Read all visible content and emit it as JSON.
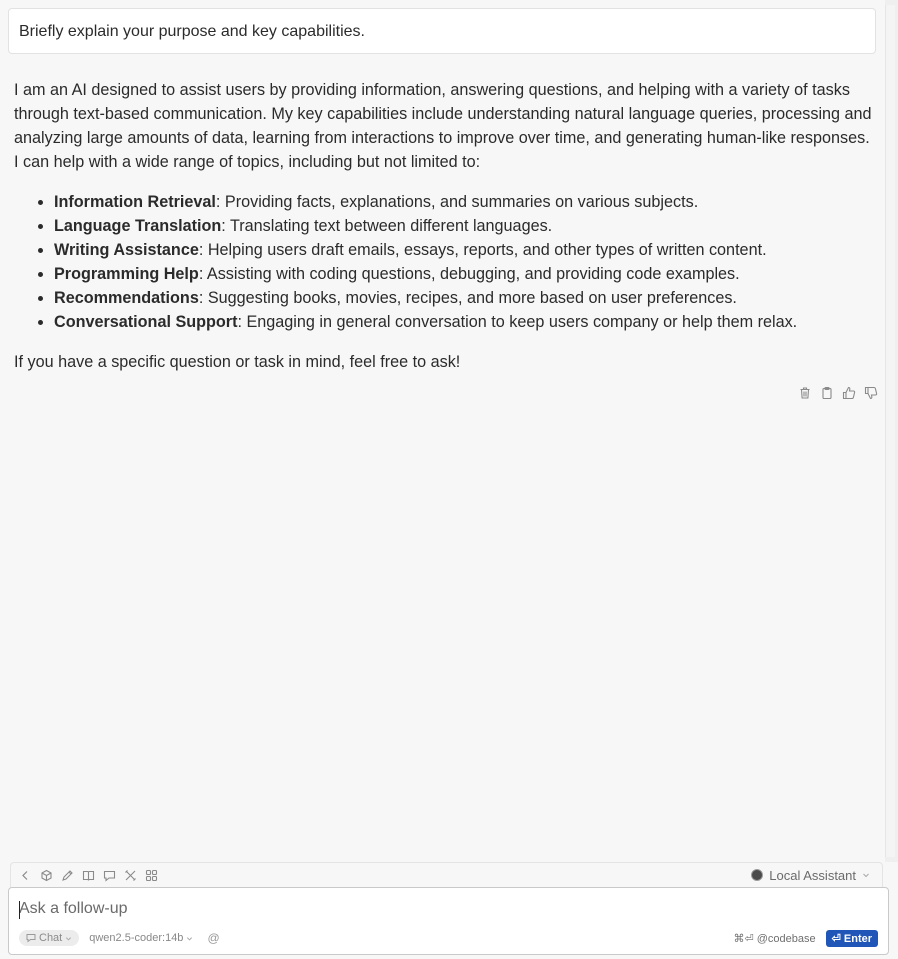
{
  "user_message": "Briefly explain your purpose and key capabilities.",
  "answer": {
    "intro": "I am an AI designed to assist users by providing information, answering questions, and helping with a variety of tasks through text-based communication. My key capabilities include understanding natural language queries, processing and analyzing large amounts of data, learning from interactions to improve over time, and generating human-like responses. I can help with a wide range of topics, including but not limited to:",
    "items": [
      {
        "term": "Information Retrieval",
        "desc": ": Providing facts, explanations, and summaries on various subjects."
      },
      {
        "term": "Language Translation",
        "desc": ": Translating text between different languages."
      },
      {
        "term": "Writing Assistance",
        "desc": ": Helping users draft emails, essays, reports, and other types of written content."
      },
      {
        "term": "Programming Help",
        "desc": ": Assisting with coding questions, debugging, and providing code examples."
      },
      {
        "term": "Recommendations",
        "desc": ": Suggesting books, movies, recipes, and more based on user preferences."
      },
      {
        "term": "Conversational Support",
        "desc": ": Engaging in general conversation to keep users company or help them relax."
      }
    ],
    "outro": "If you have a specific question or task in mind, feel free to ask!"
  },
  "message_actions": [
    "trash-icon",
    "clipboard-icon",
    "thumbs-up-icon",
    "thumbs-down-icon"
  ],
  "toolbar": {
    "icons": [
      "chevron-left-icon",
      "cube-icon",
      "pencil-icon",
      "book-icon",
      "comment-icon",
      "tools-icon",
      "grid-icon"
    ],
    "assistant_label": "Local Assistant"
  },
  "input": {
    "placeholder": "Ask a follow-up",
    "mode_label": "Chat",
    "model_label": "qwen2.5-coder:14b",
    "at_symbol": "@",
    "codebase_hint": "⌘⏎ @codebase",
    "enter_label": "⏎ Enter"
  },
  "colors": {
    "background": "#f7f7f7",
    "enter_button": "#2056b8",
    "text": "#2b2b2b"
  }
}
